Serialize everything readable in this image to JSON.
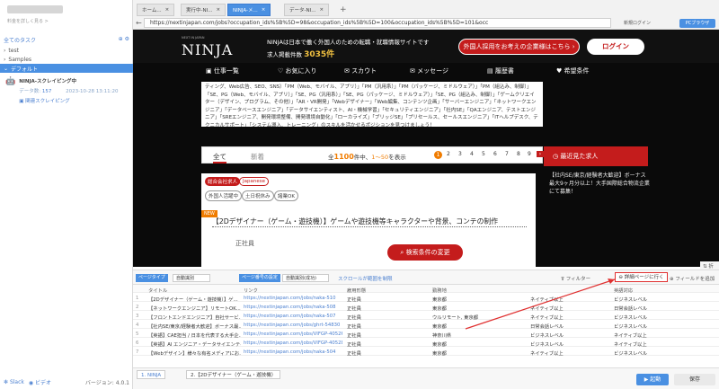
{
  "sidebar": {
    "title_blurred": "",
    "subtitle": "料金を詳しく見る >",
    "all_tasks": "全てのタスク",
    "tree": [
      {
        "label": "test"
      },
      {
        "label": "Samples"
      },
      {
        "label": "デフォルト"
      }
    ],
    "task": {
      "name": "NINJA-スクレイピング中",
      "meta_label": "データ数:",
      "meta_count": "157",
      "meta_time": "2023-10-28 13:11:20",
      "link": "関連スクレイピング"
    },
    "footer": {
      "slack": "Slack",
      "discord": "ビデオ",
      "version": "バージョン: 4.0.1"
    }
  },
  "browser": {
    "tabs": [
      {
        "label": "ホーム..."
      },
      {
        "label": "実行中-NI..."
      },
      {
        "label": "NINJA-メ..."
      },
      {
        "label": "データ-NI..."
      }
    ],
    "url": "https://nextinjapan.com/jobs?occupation_ids%5B%5D=98&occupation_ids%5B%5D=100&occupation_ids%5B%5D=101&occ",
    "login": "新規ログイン",
    "browser_btn": "PCブラウザ"
  },
  "site": {
    "logo": "NINJA",
    "logo_sub": "NEXT IN JAPAN",
    "tagline": "NINJAは日本で働く外国人のための転職・就職情報サイトです",
    "count_label": "求人掲載件数",
    "count_value": "3035件",
    "employer_btn": "外国人採用をお考えの企業様はこちら ›",
    "login_btn": "ログイン",
    "menu": [
      "仕事一覧",
      "お気に入り",
      "スカウト",
      "メッセージ",
      "履歴書",
      "希望条件"
    ],
    "filter_text": "ティング、Web広告、SEO、SNS）「PM（Web、モバイル、アプリ）」「PM（汎用系）」「PM（パッケージ、ミドルウェア）」「PM（組込み、制御）」「SE、PG（Web、モバイル、アプリ）」「SE、PG（汎用系）」「SE、PG（パッケージ、ミドルウェア）」「SE、PG（組込み、制御）」「ゲームクリエイター（デザイン、プログラム、その他）」「AR・VR開発」「Webデザイナー」「Web編集、コンテンツ企画」「サーバーエンジニア」「ネットワークエンジニア」「データベースエンジニア」「データサイエンティスト、AI・機械学習」「セキュリティエンジニア」「社内SE」「QAエンジニア、テストエンジニア」「SREエンジニア、開発環境整備、開発環境自動化」「ローカライズ」「ブリッジSE」「プリセールス、セールスエンジニア」「ITヘルプデスク、テクニカルサポート」「システム導入、トレーニング」のスキルを活かせるポジションを見つけましょう！",
    "sort_all": "全て",
    "sort_new": "新着",
    "result_prefix": "全",
    "result_count": "1100",
    "result_mid": "件中、",
    "result_range": "1〜50",
    "result_suffix": "を表示",
    "pages": [
      "1",
      "2",
      "3",
      "4",
      "5",
      "6",
      "7",
      "8",
      "9"
    ],
    "chip_company": "総合会社求人",
    "chip_japanese": "Japanese",
    "chip_tags": [
      "外国人活躍中",
      "土日祝休み",
      "諸業OK"
    ],
    "new_badge": "NEW",
    "job_title": "【2Dデザイナー（ゲーム・遊技機）】ゲームや遊技機等キャラクターや背景、コンテの制作",
    "job_detail": "正社員",
    "side_title": "最近見た求人",
    "side_text": "【社内SE/東京/経験者大歓迎】ボーナス最大9ヶ月分以上！大手国際総合物流企業にて募集！",
    "cond_btn": "検索条件の変更"
  },
  "tool": {
    "shrink": "折る",
    "page_type_label": "ページタイプ",
    "page_type_value": "自動識別",
    "paging_label": "ページ番号の設定",
    "paging_value": "自動識別(成功)",
    "scroll_link": "スクロールが範囲を制限",
    "filter": "フィルター",
    "detail_btn": "詳細ページに行く",
    "add_field": "フィールドを追加",
    "columns": [
      "",
      "タイトル",
      "リンク",
      "雇用形態",
      "勤務地",
      "",
      "英語対応"
    ],
    "rows": [
      [
        "1",
        "【2Dデザイナー（ゲーム・遊技機）】ゲ...",
        "https://nextinjapan.com/jobs/naka-510",
        "正社員",
        "東京都",
        "ネイティブ以上",
        "ビジネスレベル"
      ],
      [
        "2",
        "【ネットワークエンジニア】リモートOK...",
        "https://nextinjapan.com/jobs/naka-508",
        "正社員",
        "東京都",
        "ネイティブ以上",
        "日常会話レベル"
      ],
      [
        "3",
        "【フロントエンドエンジニア】自社サービ...",
        "https://nextinjapan.com/jobs/naka-507",
        "正社員",
        "ウルリモート, 東京都",
        "ネイティブ以上",
        "ビジネスレベル"
      ],
      [
        "4",
        "【社内SE/東京/経験者大歓迎】ボーナス最...",
        "https://nextinjapan.com/jobs/ghrt-54830",
        "正社員",
        "東京都",
        "日常会話レベル",
        "ビジネスレベル"
      ],
      [
        "5",
        "【英語】CAE担当 / 日本を代表する大手企...",
        "https://nextinjapan.com/jobs/VIFGP-40526",
        "正社員",
        "神奈川県",
        "ビジネスレベル",
        "ネイティブ以上"
      ],
      [
        "6",
        "【英語】AI エンジニア・データサイエンティ...",
        "https://nextinjapan.com/jobs/VIFGP-40528",
        "正社員",
        "東京都",
        "ビジネスレベル",
        "ネイティブ以上"
      ],
      [
        "7",
        "【Webデザイン】様々な有名メディアにお...",
        "https://nextinjapan.com/jobs/naka-504",
        "正社員",
        "東京都",
        "ネイティブ以上",
        "ビジネスレベル"
      ]
    ],
    "bottom_tabs": [
      "1. NINJA",
      "2.【2Dデザイナー（ゲーム・遊技機）"
    ],
    "start_btn": "▶ 起動",
    "save_btn": "保存"
  },
  "colors": {
    "accent": "#4a90e2",
    "brand_red": "#c41c1c",
    "site_bg": "#0a0a0a"
  }
}
